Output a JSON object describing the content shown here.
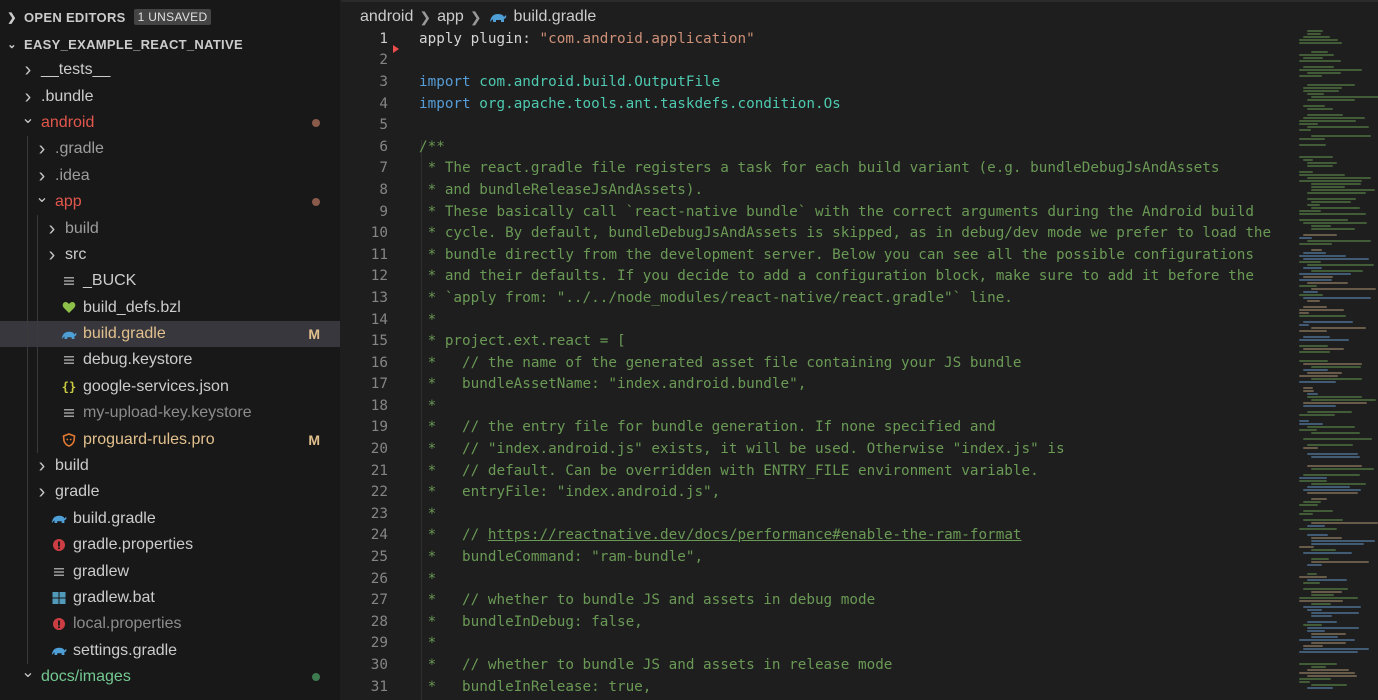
{
  "sidebar": {
    "open_editors": {
      "title": "OPEN EDITORS",
      "badge": "1 UNSAVED"
    },
    "project": {
      "title": "EASY_EXAMPLE_REACT_NATIVE"
    },
    "tree": [
      {
        "label": "__tests__",
        "indent": 0,
        "twisty": "›",
        "icon": "",
        "color": "#cccccc"
      },
      {
        "label": ".bundle",
        "indent": 0,
        "twisty": "›",
        "icon": "",
        "color": "#cccccc"
      },
      {
        "label": "android",
        "indent": 0,
        "twisty": "⌄",
        "icon": "",
        "color": "#e2574c",
        "dot": "#8a5a4a"
      },
      {
        "label": ".gradle",
        "indent": 1,
        "twisty": "›",
        "icon": "",
        "color": "#9d9d9d"
      },
      {
        "label": ".idea",
        "indent": 1,
        "twisty": "›",
        "icon": "",
        "color": "#9d9d9d"
      },
      {
        "label": "app",
        "indent": 1,
        "twisty": "⌄",
        "icon": "",
        "color": "#e2574c",
        "dot": "#8a5a4a"
      },
      {
        "label": "build",
        "indent": 2,
        "twisty": "›",
        "icon": "",
        "color": "#9d9d9d"
      },
      {
        "label": "src",
        "indent": 2,
        "twisty": "›",
        "icon": "",
        "color": "#cccccc"
      },
      {
        "label": "_BUCK",
        "indent": 2,
        "twisty": "",
        "icon": "lines-icon",
        "color": "#cccccc"
      },
      {
        "label": "build_defs.bzl",
        "indent": 2,
        "twisty": "",
        "icon": "heart-icon",
        "color": "#cccccc"
      },
      {
        "label": "build.gradle",
        "indent": 2,
        "twisty": "",
        "icon": "gradle-icon",
        "color": "#e2c08d",
        "mark": "M",
        "selected": true
      },
      {
        "label": "debug.keystore",
        "indent": 2,
        "twisty": "",
        "icon": "lines-icon",
        "color": "#cccccc"
      },
      {
        "label": "google-services.json",
        "indent": 2,
        "twisty": "",
        "icon": "json-icon",
        "color": "#cccccc"
      },
      {
        "label": "my-upload-key.keystore",
        "indent": 2,
        "twisty": "",
        "icon": "lines-icon",
        "color": "#8c8c8c"
      },
      {
        "label": "proguard-rules.pro",
        "indent": 2,
        "twisty": "",
        "icon": "shield-icon",
        "color": "#e2c08d",
        "mark": "M"
      },
      {
        "label": "build",
        "indent": 1,
        "twisty": "›",
        "icon": "",
        "color": "#cccccc"
      },
      {
        "label": "gradle",
        "indent": 1,
        "twisty": "›",
        "icon": "",
        "color": "#cccccc"
      },
      {
        "label": "build.gradle",
        "indent": 1,
        "twisty": "",
        "icon": "gradle-icon",
        "color": "#cccccc"
      },
      {
        "label": "gradle.properties",
        "indent": 1,
        "twisty": "",
        "icon": "java-icon",
        "color": "#cccccc"
      },
      {
        "label": "gradlew",
        "indent": 1,
        "twisty": "",
        "icon": "lines-icon",
        "color": "#cccccc"
      },
      {
        "label": "gradlew.bat",
        "indent": 1,
        "twisty": "",
        "icon": "windows-icon",
        "color": "#cccccc"
      },
      {
        "label": "local.properties",
        "indent": 1,
        "twisty": "",
        "icon": "java-icon",
        "color": "#8c8c8c"
      },
      {
        "label": "settings.gradle",
        "indent": 1,
        "twisty": "",
        "icon": "gradle-icon",
        "color": "#cccccc"
      },
      {
        "label": "docs/images",
        "indent": 0,
        "twisty": "⌄",
        "icon": "",
        "color": "#73c991",
        "dot": "#3d7a4f"
      }
    ]
  },
  "editor": {
    "breadcrumb": [
      "android",
      "app",
      "build.gradle"
    ],
    "active_line": 1,
    "lines": [
      {
        "n": "1",
        "parts": [
          [
            "apply plugin: ",
            "d"
          ],
          [
            "\"com.android.application\"",
            "s"
          ]
        ]
      },
      {
        "n": "2",
        "parts": []
      },
      {
        "n": "3",
        "parts": [
          [
            "import ",
            "k"
          ],
          [
            "com.android.build.OutputFile",
            "t"
          ]
        ]
      },
      {
        "n": "4",
        "parts": [
          [
            "import ",
            "k"
          ],
          [
            "org.apache.tools.ant.taskdefs.condition.Os",
            "t"
          ]
        ]
      },
      {
        "n": "5",
        "parts": []
      },
      {
        "n": "6",
        "parts": [
          [
            "/**",
            "c"
          ]
        ]
      },
      {
        "n": "7",
        "parts": [
          [
            " * The react.gradle file registers a task for each build variant (e.g. bundleDebugJsAndAssets",
            "c"
          ]
        ]
      },
      {
        "n": "8",
        "parts": [
          [
            " * and bundleReleaseJsAndAssets).",
            "c"
          ]
        ]
      },
      {
        "n": "9",
        "parts": [
          [
            " * These basically call `react-native bundle` with the correct arguments during the Android build",
            "c"
          ]
        ]
      },
      {
        "n": "10",
        "parts": [
          [
            " * cycle. By default, bundleDebugJsAndAssets is skipped, as in debug/dev mode we prefer to load the",
            "c"
          ]
        ]
      },
      {
        "n": "11",
        "parts": [
          [
            " * bundle directly from the development server. Below you can see all the possible configurations",
            "c"
          ]
        ]
      },
      {
        "n": "12",
        "parts": [
          [
            " * and their defaults. If you decide to add a configuration block, make sure to add it before the",
            "c"
          ]
        ]
      },
      {
        "n": "13",
        "parts": [
          [
            " * `apply from: \"../../node_modules/react-native/react.gradle\"` line.",
            "c"
          ]
        ]
      },
      {
        "n": "14",
        "parts": [
          [
            " *",
            "c"
          ]
        ]
      },
      {
        "n": "15",
        "parts": [
          [
            " * project.ext.react = [",
            "c"
          ]
        ]
      },
      {
        "n": "16",
        "parts": [
          [
            " *   // the name of the generated asset file containing your JS bundle",
            "c"
          ]
        ]
      },
      {
        "n": "17",
        "parts": [
          [
            " *   bundleAssetName: \"index.android.bundle\",",
            "c"
          ]
        ]
      },
      {
        "n": "18",
        "parts": [
          [
            " *",
            "c"
          ]
        ]
      },
      {
        "n": "19",
        "parts": [
          [
            " *   // the entry file for bundle generation. If none specified and",
            "c"
          ]
        ]
      },
      {
        "n": "20",
        "parts": [
          [
            " *   // \"index.android.js\" exists, it will be used. Otherwise \"index.js\" is",
            "c"
          ]
        ]
      },
      {
        "n": "21",
        "parts": [
          [
            " *   // default. Can be overridden with ENTRY_FILE environment variable.",
            "c"
          ]
        ]
      },
      {
        "n": "22",
        "parts": [
          [
            " *   entryFile: \"index.android.js\",",
            "c"
          ]
        ]
      },
      {
        "n": "23",
        "parts": [
          [
            " *",
            "c"
          ]
        ]
      },
      {
        "n": "24",
        "parts": [
          [
            " *   // ",
            "c"
          ],
          [
            "https://reactnative.dev/docs/performance#enable-the-ram-format",
            "l"
          ]
        ]
      },
      {
        "n": "25",
        "parts": [
          [
            " *   bundleCommand: \"ram-bundle\",",
            "c"
          ]
        ]
      },
      {
        "n": "26",
        "parts": [
          [
            " *",
            "c"
          ]
        ]
      },
      {
        "n": "27",
        "parts": [
          [
            " *   // whether to bundle JS and assets in debug mode",
            "c"
          ]
        ]
      },
      {
        "n": "28",
        "parts": [
          [
            " *   bundleInDebug: false,",
            "c"
          ]
        ]
      },
      {
        "n": "29",
        "parts": [
          [
            " *",
            "c"
          ]
        ]
      },
      {
        "n": "30",
        "parts": [
          [
            " *   // whether to bundle JS and assets in release mode",
            "c"
          ]
        ]
      },
      {
        "n": "31",
        "parts": [
          [
            " *   bundleInRelease: true,",
            "c"
          ]
        ]
      }
    ]
  },
  "colors": {
    "background": "#1e1e1e",
    "sidebar": "#181818",
    "selection": "#37373d",
    "comment": "#6a9955",
    "string": "#ce9178",
    "keyword": "#569cd6",
    "type": "#4ec9b0",
    "modified": "#e2c08d",
    "error": "#f14c4c"
  }
}
